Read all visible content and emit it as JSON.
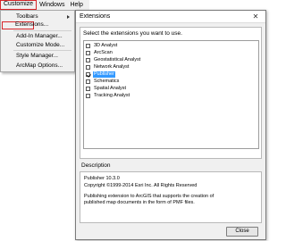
{
  "menubar": {
    "items": [
      {
        "label": "Customize"
      },
      {
        "label": "Windows"
      },
      {
        "label": "Help"
      }
    ]
  },
  "dropdown": {
    "items": [
      {
        "label": "Toolbars"
      },
      {
        "label": "Extensions..."
      },
      {
        "label": "Add-In Manager..."
      },
      {
        "label": "Customize Mode..."
      },
      {
        "label": "Style Manager..."
      },
      {
        "label": "ArcMap Options..."
      }
    ]
  },
  "dialog": {
    "title": "Extensions",
    "close_glyph": "✕",
    "prompt": "Select the extensions you want to use.",
    "extensions": [
      {
        "label": "3D Analyst",
        "checked": false,
        "selected": false
      },
      {
        "label": "ArcScan",
        "checked": false,
        "selected": false
      },
      {
        "label": "Geostatistical Analyst",
        "checked": false,
        "selected": false
      },
      {
        "label": "Network Analyst",
        "checked": false,
        "selected": false
      },
      {
        "label": "Publisher",
        "checked": true,
        "selected": true
      },
      {
        "label": "Schematics",
        "checked": false,
        "selected": false
      },
      {
        "label": "Spatial Analyst",
        "checked": false,
        "selected": false
      },
      {
        "label": "Tracking Analyst",
        "checked": false,
        "selected": false
      }
    ],
    "description_heading": "Description",
    "description": {
      "line1": "Publisher 10.3.0",
      "line2": "Copyright ©1999-2014 Esri Inc. All Rights Reserved",
      "line3": "Publishing extension to ArcGIS that supports the creation of",
      "line4": "published map documents in the form of PMF files."
    },
    "close_button": "Close"
  },
  "colors": {
    "highlight_border": "#d7262b",
    "selection": "#3399ff"
  }
}
